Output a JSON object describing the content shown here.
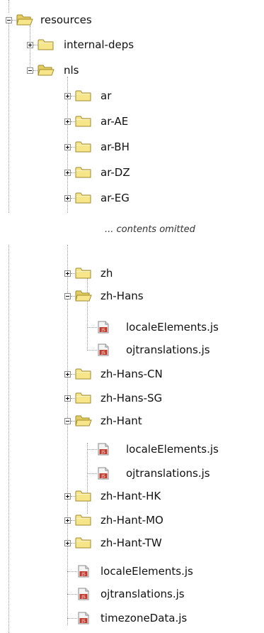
{
  "tree": {
    "root": {
      "label": "resources",
      "expanded": true,
      "icon": "folder-open-icon"
    },
    "items": [
      {
        "label": "internal-deps",
        "type": "folder",
        "expanded": false
      },
      {
        "label": "nls",
        "type": "folder",
        "expanded": true
      },
      {
        "label": "ar",
        "type": "folder",
        "expanded": false
      },
      {
        "label": "ar-AE",
        "type": "folder",
        "expanded": false
      },
      {
        "label": "ar-BH",
        "type": "folder",
        "expanded": false
      },
      {
        "label": "ar-DZ",
        "type": "folder",
        "expanded": false
      },
      {
        "label": "ar-EG",
        "type": "folder",
        "expanded": false
      },
      {
        "label": "zh",
        "type": "folder",
        "expanded": false
      },
      {
        "label": "zh-Hans",
        "type": "folder",
        "expanded": true
      },
      {
        "label": "localeElements.js",
        "type": "js-file"
      },
      {
        "label": "ojtranslations.js",
        "type": "js-file"
      },
      {
        "label": "zh-Hans-CN",
        "type": "folder",
        "expanded": false
      },
      {
        "label": "zh-Hans-SG",
        "type": "folder",
        "expanded": false
      },
      {
        "label": "zh-Hant",
        "type": "folder",
        "expanded": true
      },
      {
        "label": "localeElements.js",
        "type": "js-file"
      },
      {
        "label": "ojtranslations.js",
        "type": "js-file"
      },
      {
        "label": "zh-Hant-HK",
        "type": "folder",
        "expanded": false
      },
      {
        "label": "zh-Hant-MO",
        "type": "folder",
        "expanded": false
      },
      {
        "label": "zh-Hant-TW",
        "type": "folder",
        "expanded": false
      },
      {
        "label": "localeElements.js",
        "type": "js-file"
      },
      {
        "label": "ojtranslations.js",
        "type": "js-file"
      },
      {
        "label": "timezoneData.js",
        "type": "js-file"
      }
    ],
    "omitted_note": "... contents omitted"
  },
  "colors": {
    "folder_fill": "#f7e58a",
    "folder_stroke": "#a08a2c",
    "js_badge": "#c0392b",
    "connector": "#9a9a9a"
  }
}
